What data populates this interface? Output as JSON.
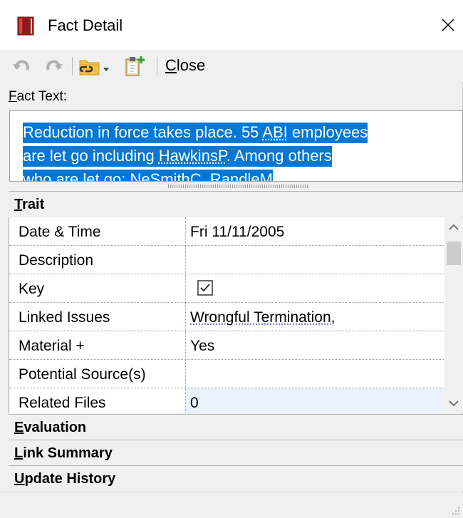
{
  "window": {
    "title": "Fact Detail"
  },
  "toolbar": {
    "close_label": "Close",
    "close_mnemonic": "C",
    "close_rest": "lose"
  },
  "fact_text": {
    "label_mnemonic": "F",
    "label_rest": "act Text:",
    "lines": [
      {
        "a": "Reduction in force takes place.  55 ",
        "b": "ABI",
        "c": " employees"
      },
      {
        "a": "are let go including ",
        "b": "HawkinsP",
        "c": ".  Among others"
      },
      {
        "a": "who are let go: ",
        "b": "NeSmithC",
        "c": ", ",
        "d": "RandleM"
      }
    ]
  },
  "sections": {
    "trait": {
      "mnemonic": "T",
      "rest": "rait"
    },
    "evaluation": {
      "mnemonic": "E",
      "rest": "valuation"
    },
    "link_summary": {
      "mnemonic": "L",
      "rest": "ink Summary"
    },
    "update_history": {
      "mnemonic": "U",
      "rest": "pdate History"
    }
  },
  "properties": [
    {
      "name": "Date & Time",
      "value": "Fri 11/11/2005"
    },
    {
      "name": "Description",
      "value": ""
    },
    {
      "name": "Key",
      "value": "",
      "checked": true
    },
    {
      "name": "Linked Issues",
      "value": "Wrongful Termination,"
    },
    {
      "name": "Material +",
      "value": "Yes"
    },
    {
      "name": "Potential Source(s)",
      "value": ""
    },
    {
      "name": "Related Files",
      "value": "0"
    }
  ],
  "icons": {
    "app": "red-book-icon",
    "close": "close-icon",
    "undo": "undo-icon",
    "redo": "redo-icon",
    "link": "folder-link-icon",
    "paste": "clipboard-add-icon"
  },
  "colors": {
    "selection": "#0078d7",
    "app_icon": "#b52a2a"
  }
}
